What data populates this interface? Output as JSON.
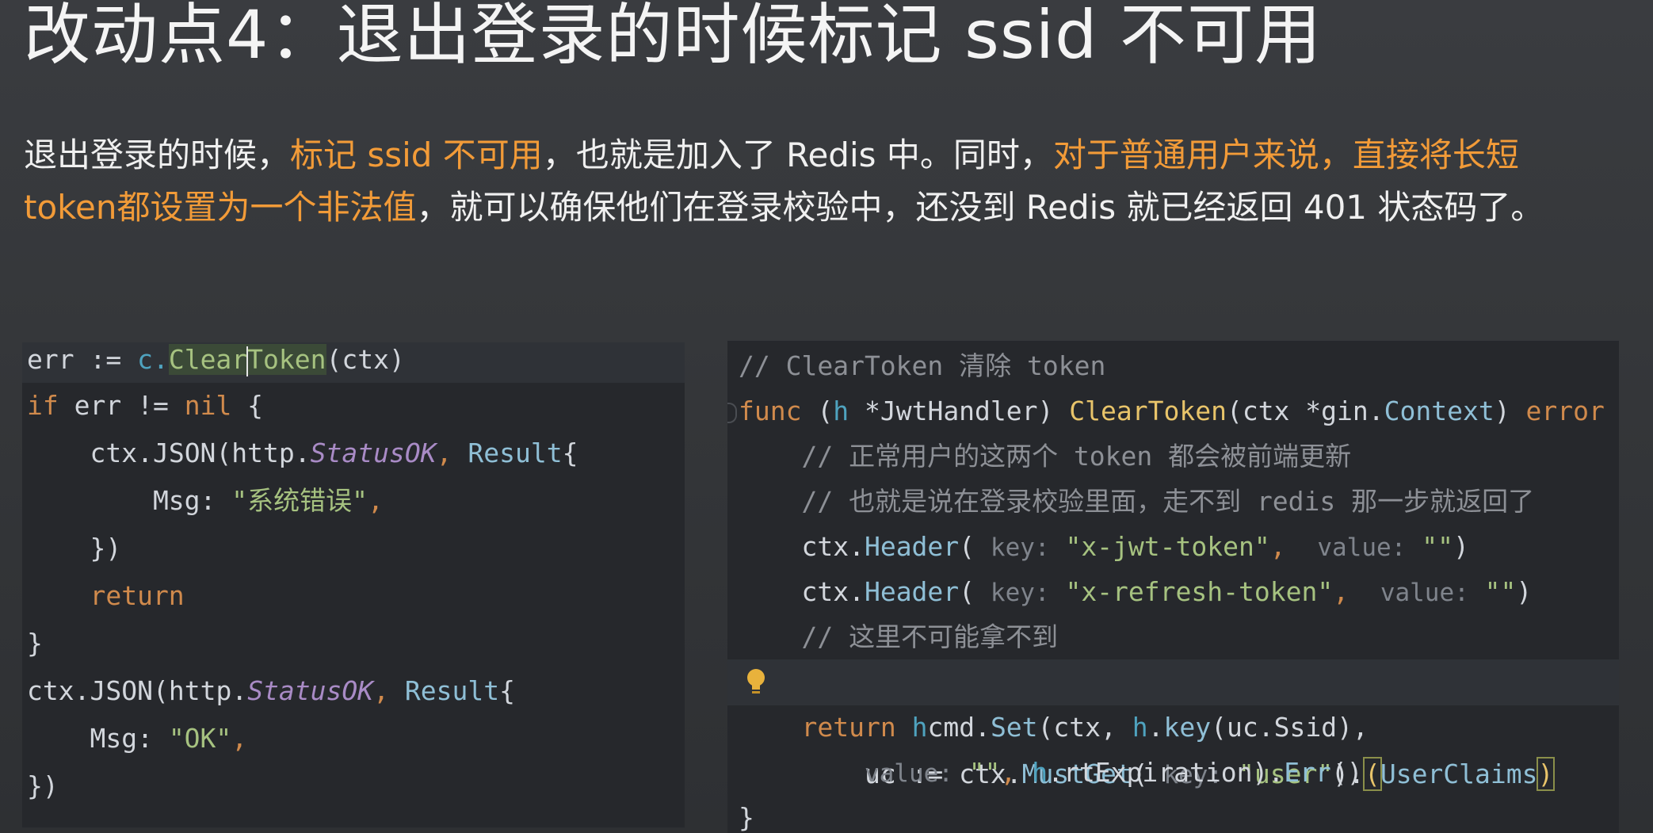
{
  "title": "改动点4：退出登录的时候标记 ssid 不可用",
  "description": {
    "p1": "退出登录的时候，",
    "h1": "标记 ssid 不可用",
    "p2": "，也就是加入了 Redis 中。同时，",
    "h2": "对于普通用户来说，直接将长短 token都设置为一个非法值",
    "p3": "，就可以确保他们在登录校验中，还没到 Redis 就已经返回 401 状态码了。"
  },
  "left_code": {
    "l1": {
      "a": "err := ",
      "b": "c.",
      "c": "Clear",
      "d": "Token",
      "e": "(ctx)"
    },
    "l2": {
      "a": "if",
      "b": " err != ",
      "c": "nil",
      "d": " {"
    },
    "l3": {
      "a": "    ctx.",
      "b": "JSON",
      "c": "(http.",
      "d": "StatusOK",
      "e": ", ",
      "f": "Result",
      "g": "{"
    },
    "l4": {
      "a": "        Msg: ",
      "b": "\"系统错误\"",
      "c": ","
    },
    "l5": {
      "a": "    })"
    },
    "l6": {
      "a": "    return"
    },
    "l7": {
      "a": "}"
    },
    "l8": {
      "a": "ctx.",
      "b": "JSON",
      "c": "(http.",
      "d": "StatusOK",
      "e": ", ",
      "f": "Result",
      "g": "{"
    },
    "l9": {
      "a": "    Msg: ",
      "b": "\"OK\"",
      "c": ","
    },
    "l10": {
      "a": "})"
    }
  },
  "right_code": {
    "r1": "// ClearToken 清除 token",
    "r2": {
      "a": "func",
      "b": " (",
      "c": "h",
      "d": " *JwtHandler) ",
      "e": "ClearToken",
      "f": "(ctx *",
      "g": "gin.",
      "h": "Context",
      "i": ") ",
      "j": "error"
    },
    "r3": "    // 正常用户的这两个 token 都会被前端更新",
    "r4": "    // 也就是说在登录校验里面，走不到 redis 那一步就返回了",
    "r5": {
      "a": "    ctx.",
      "b": "Header",
      "c": "( ",
      "d": "key:",
      "e": " \"x-jwt-token\"",
      "f": ",  ",
      "g": "value:",
      "h": " \"\"",
      "i": ")"
    },
    "r6": {
      "a": "    ctx.",
      "b": "Header",
      "c": "( ",
      "d": "key:",
      "e": " \"x-refresh-token\"",
      "f": ",  ",
      "g": "value:",
      "h": " \"\"",
      "i": ")"
    },
    "r7": "    // 这里不可能拿不到",
    "r8": {
      "a": "    uc := ctx.",
      "b": "MustGet",
      "c": "( ",
      "d": "key:",
      "e": " \"user\"",
      "f": ").",
      "g": "(",
      "h": "UserClaims",
      "i": ")"
    },
    "r9": {
      "a": "    ",
      "b": "return",
      "c": " ",
      "d": "h",
      ".": ".",
      "e": "cmd.",
      "f": "Set",
      "g": "(ctx, ",
      "h": "h",
      "i": ".",
      "j": "key",
      "k": "(uc.Ssid),"
    },
    "r10": {
      "a": "        ",
      "b": "value:",
      "c": " \"\"",
      "d": ", ",
      "e": "h",
      "f": ".rtExpiration).",
      "g": "Err",
      "h": "()"
    },
    "r11": "}"
  }
}
